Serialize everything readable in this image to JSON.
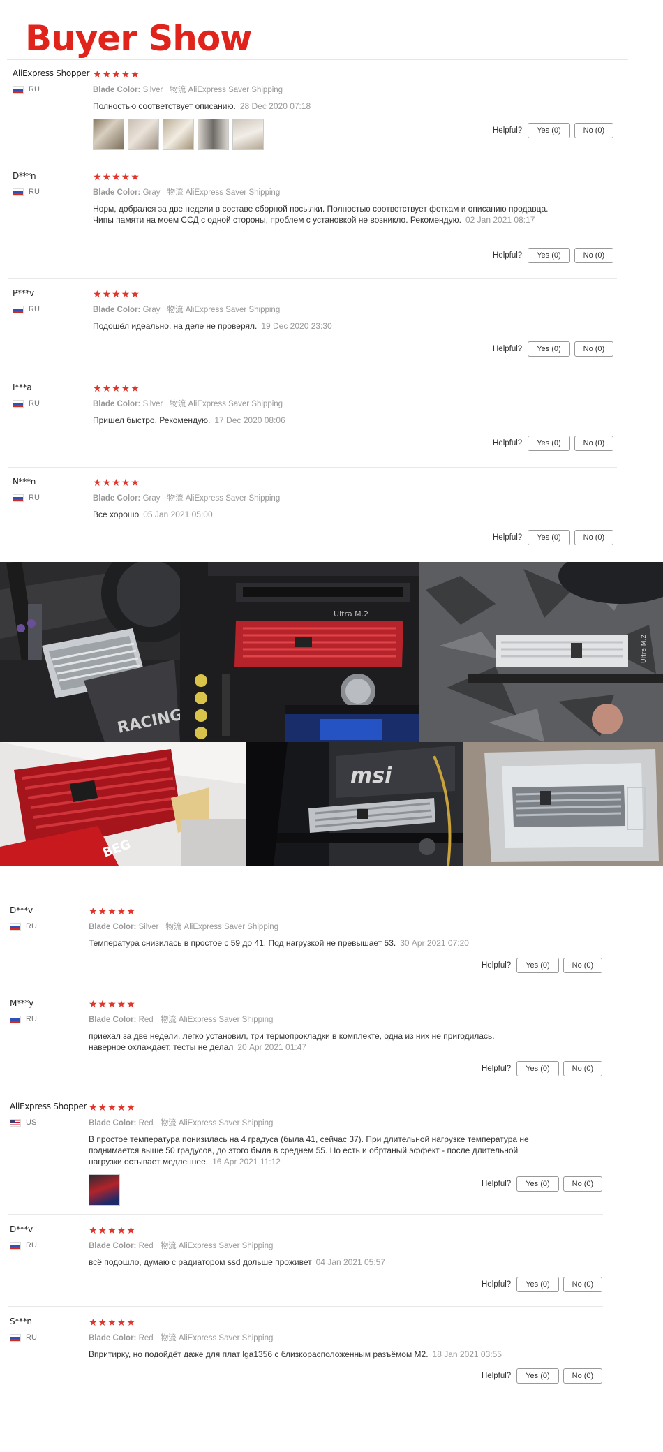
{
  "page": {
    "title": "Buyer Show"
  },
  "labels": {
    "helpful": "Helpful?",
    "blade_color": "Blade Color:",
    "shipping_label": "物流",
    "yes": "Yes (0)",
    "no": "No (0)"
  },
  "stars": "★★★★★",
  "reviews_top": [
    {
      "name": "AliExpress Shopper",
      "country": "RU",
      "color": "Silver",
      "shipping": "AliExpress Saver Shipping",
      "text": "Полностью соответствует описанию.",
      "date": "28 Dec 2020 07:18"
    },
    {
      "name": "D***n",
      "country": "RU",
      "color": "Gray",
      "shipping": "AliExpress Saver Shipping",
      "text": "Норм, добрался за две недели в составе сборной посылки. Полностью соответствует фоткам и описанию продавца. Чипы памяти на моем ССД с одной стороны, проблем с установкой не возникло. Рекомендую.",
      "date": "02 Jan 2021 08:17"
    },
    {
      "name": "P***v",
      "country": "RU",
      "color": "Gray",
      "shipping": "AliExpress Saver Shipping",
      "text": "Подошёл идеально, на деле не проверял.",
      "date": "19 Dec 2020 23:30"
    },
    {
      "name": "I***a",
      "country": "RU",
      "color": "Silver",
      "shipping": "AliExpress Saver Shipping",
      "text": "Пришел быстро. Рекомендую.",
      "date": "17 Dec 2020 08:06"
    },
    {
      "name": "N***n",
      "country": "RU",
      "color": "Gray",
      "shipping": "AliExpress Saver Shipping",
      "text": "Все хорошо",
      "date": "05 Jan 2021 05:00"
    }
  ],
  "reviews_bottom": [
    {
      "name": "D***v",
      "country": "RU",
      "color": "Silver",
      "shipping": "AliExpress Saver Shipping",
      "text": "Температура снизилась в простое с 59 до 41. Под нагрузкой не превышает 53.",
      "date": "30 Apr 2021 07:20"
    },
    {
      "name": "M***y",
      "country": "RU",
      "color": "Red",
      "shipping": "AliExpress Saver Shipping",
      "text": "приехал за две недели, легко установил, три термопрокладки в комплекте, одна из них не пригодилась. наверное охлаждает, тесты не делал",
      "date": "20 Apr 2021 01:47"
    },
    {
      "name": "AliExpress Shopper",
      "country": "US",
      "color": "Red",
      "shipping": "AliExpress Saver Shipping",
      "text": "В простое температура понизилась на 4 градуса (была 41, сейчас 37). При длительной нагрузке температура не поднимается выше 50 градусов, до этого была в среднем 55. Но есть и обртаный эффект - после длительной нагрузки остывает медленнее.",
      "date": "16 Apr 2021 11:12"
    },
    {
      "name": "D***v",
      "country": "RU",
      "color": "Red",
      "shipping": "AliExpress Saver Shipping",
      "text": "всё подошло, думаю с радиатором ssd дольше проживет",
      "date": "04 Jan 2021 05:57"
    },
    {
      "name": "S***n",
      "country": "RU",
      "color": "Red",
      "shipping": "AliExpress Saver Shipping",
      "text": "Впритирку, но подойдёт даже для плат lga1356 с близкорасположенным разъёмом M2.",
      "date": "18 Jan 2021 03:55"
    }
  ],
  "photo_labels": {
    "m2": "Ultra M.2",
    "msi": "msi",
    "racing": "RACING"
  }
}
